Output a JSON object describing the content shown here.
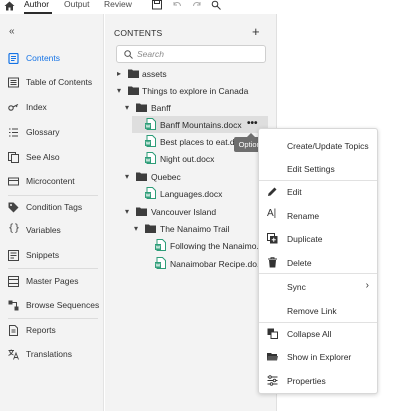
{
  "toolbar": {
    "tabs": [
      {
        "label": "Author",
        "active": true
      },
      {
        "label": "Output",
        "active": false
      },
      {
        "label": "Review",
        "active": false
      }
    ],
    "icons": [
      "home-icon",
      "save-icon",
      "undo-icon",
      "redo-icon",
      "find-replace-icon"
    ]
  },
  "sidebar": {
    "items": [
      {
        "label": "Contents",
        "icon": "contents-icon",
        "active": true
      },
      {
        "label": "Table of Contents",
        "icon": "toc-icon"
      },
      {
        "label": "Index",
        "icon": "key-icon"
      },
      {
        "label": "Glossary",
        "icon": "glossary-icon"
      },
      {
        "label": "See Also",
        "icon": "see-also-icon"
      },
      {
        "label": "Microcontent",
        "icon": "microcontent-icon"
      },
      {
        "label": "Condition Tags",
        "icon": "tag-icon"
      },
      {
        "label": "Variables",
        "icon": "braces-icon"
      },
      {
        "label": "Snippets",
        "icon": "snippet-icon"
      },
      {
        "label": "Master Pages",
        "icon": "master-pages-icon"
      },
      {
        "label": "Browse Sequences",
        "icon": "browse-sequence-icon"
      },
      {
        "label": "Reports",
        "icon": "reports-icon"
      },
      {
        "label": "Translations",
        "icon": "translation-icon"
      }
    ]
  },
  "contents": {
    "title": "CONTENTS",
    "add_label": "+",
    "search_placeholder": "Search",
    "tree": [
      {
        "label": "assets",
        "type": "folder",
        "expanded": false
      },
      {
        "label": "Things to explore in Canada",
        "type": "folder",
        "expanded": true
      },
      {
        "label": "Banff",
        "type": "folder",
        "expanded": true
      },
      {
        "label": "Banff Mountains.docx",
        "type": "doc",
        "selected": true
      },
      {
        "label": "Best places to eat.docx",
        "type": "doc"
      },
      {
        "label": "Night out.docx",
        "type": "doc"
      },
      {
        "label": "Quebec",
        "type": "folder",
        "expanded": true
      },
      {
        "label": "Languages.docx",
        "type": "doc"
      },
      {
        "label": "Vancouver Island",
        "type": "folder",
        "expanded": true
      },
      {
        "label": "The Nanaimo Trail",
        "type": "folder",
        "expanded": true
      },
      {
        "label": "Following the Nanaimo...",
        "type": "doc"
      },
      {
        "label": "Nanaimobar Recipe.do...",
        "type": "doc"
      }
    ],
    "more_label": "•••",
    "tooltip": "Options"
  },
  "context_menu": {
    "items": [
      {
        "label": "Create/Update Topics",
        "icon": ""
      },
      {
        "label": "Edit Settings",
        "icon": ""
      },
      {
        "label": "Edit",
        "icon": "pencil-icon"
      },
      {
        "label": "Rename",
        "icon": "rename-icon"
      },
      {
        "label": "Duplicate",
        "icon": "duplicate-icon"
      },
      {
        "label": "Delete",
        "icon": "trash-icon"
      },
      {
        "label": "Sync",
        "icon": "",
        "submenu": true
      },
      {
        "label": "Remove Link",
        "icon": ""
      },
      {
        "label": "Collapse All",
        "icon": "collapse-all-icon"
      },
      {
        "label": "Show in Explorer",
        "icon": "folder-open-icon"
      },
      {
        "label": "Properties",
        "icon": "properties-icon"
      }
    ]
  },
  "colors": {
    "accent": "#1473e6",
    "doc_green": "#2d9d78",
    "selection": "#dedede"
  }
}
